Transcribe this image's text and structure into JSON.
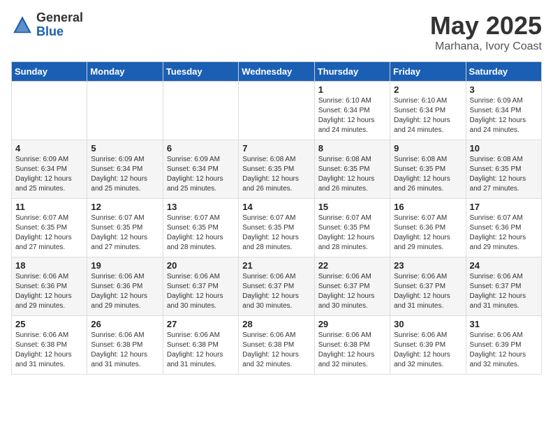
{
  "header": {
    "logo_general": "General",
    "logo_blue": "Blue",
    "month_year": "May 2025",
    "location": "Marhana, Ivory Coast"
  },
  "weekdays": [
    "Sunday",
    "Monday",
    "Tuesday",
    "Wednesday",
    "Thursday",
    "Friday",
    "Saturday"
  ],
  "weeks": [
    [
      {
        "day": "",
        "info": ""
      },
      {
        "day": "",
        "info": ""
      },
      {
        "day": "",
        "info": ""
      },
      {
        "day": "",
        "info": ""
      },
      {
        "day": "1",
        "info": "Sunrise: 6:10 AM\nSunset: 6:34 PM\nDaylight: 12 hours\nand 24 minutes."
      },
      {
        "day": "2",
        "info": "Sunrise: 6:10 AM\nSunset: 6:34 PM\nDaylight: 12 hours\nand 24 minutes."
      },
      {
        "day": "3",
        "info": "Sunrise: 6:09 AM\nSunset: 6:34 PM\nDaylight: 12 hours\nand 24 minutes."
      }
    ],
    [
      {
        "day": "4",
        "info": "Sunrise: 6:09 AM\nSunset: 6:34 PM\nDaylight: 12 hours\nand 25 minutes."
      },
      {
        "day": "5",
        "info": "Sunrise: 6:09 AM\nSunset: 6:34 PM\nDaylight: 12 hours\nand 25 minutes."
      },
      {
        "day": "6",
        "info": "Sunrise: 6:09 AM\nSunset: 6:34 PM\nDaylight: 12 hours\nand 25 minutes."
      },
      {
        "day": "7",
        "info": "Sunrise: 6:08 AM\nSunset: 6:35 PM\nDaylight: 12 hours\nand 26 minutes."
      },
      {
        "day": "8",
        "info": "Sunrise: 6:08 AM\nSunset: 6:35 PM\nDaylight: 12 hours\nand 26 minutes."
      },
      {
        "day": "9",
        "info": "Sunrise: 6:08 AM\nSunset: 6:35 PM\nDaylight: 12 hours\nand 26 minutes."
      },
      {
        "day": "10",
        "info": "Sunrise: 6:08 AM\nSunset: 6:35 PM\nDaylight: 12 hours\nand 27 minutes."
      }
    ],
    [
      {
        "day": "11",
        "info": "Sunrise: 6:07 AM\nSunset: 6:35 PM\nDaylight: 12 hours\nand 27 minutes."
      },
      {
        "day": "12",
        "info": "Sunrise: 6:07 AM\nSunset: 6:35 PM\nDaylight: 12 hours\nand 27 minutes."
      },
      {
        "day": "13",
        "info": "Sunrise: 6:07 AM\nSunset: 6:35 PM\nDaylight: 12 hours\nand 28 minutes."
      },
      {
        "day": "14",
        "info": "Sunrise: 6:07 AM\nSunset: 6:35 PM\nDaylight: 12 hours\nand 28 minutes."
      },
      {
        "day": "15",
        "info": "Sunrise: 6:07 AM\nSunset: 6:35 PM\nDaylight: 12 hours\nand 28 minutes."
      },
      {
        "day": "16",
        "info": "Sunrise: 6:07 AM\nSunset: 6:36 PM\nDaylight: 12 hours\nand 29 minutes."
      },
      {
        "day": "17",
        "info": "Sunrise: 6:07 AM\nSunset: 6:36 PM\nDaylight: 12 hours\nand 29 minutes."
      }
    ],
    [
      {
        "day": "18",
        "info": "Sunrise: 6:06 AM\nSunset: 6:36 PM\nDaylight: 12 hours\nand 29 minutes."
      },
      {
        "day": "19",
        "info": "Sunrise: 6:06 AM\nSunset: 6:36 PM\nDaylight: 12 hours\nand 29 minutes."
      },
      {
        "day": "20",
        "info": "Sunrise: 6:06 AM\nSunset: 6:37 PM\nDaylight: 12 hours\nand 30 minutes."
      },
      {
        "day": "21",
        "info": "Sunrise: 6:06 AM\nSunset: 6:37 PM\nDaylight: 12 hours\nand 30 minutes."
      },
      {
        "day": "22",
        "info": "Sunrise: 6:06 AM\nSunset: 6:37 PM\nDaylight: 12 hours\nand 30 minutes."
      },
      {
        "day": "23",
        "info": "Sunrise: 6:06 AM\nSunset: 6:37 PM\nDaylight: 12 hours\nand 31 minutes."
      },
      {
        "day": "24",
        "info": "Sunrise: 6:06 AM\nSunset: 6:37 PM\nDaylight: 12 hours\nand 31 minutes."
      }
    ],
    [
      {
        "day": "25",
        "info": "Sunrise: 6:06 AM\nSunset: 6:38 PM\nDaylight: 12 hours\nand 31 minutes."
      },
      {
        "day": "26",
        "info": "Sunrise: 6:06 AM\nSunset: 6:38 PM\nDaylight: 12 hours\nand 31 minutes."
      },
      {
        "day": "27",
        "info": "Sunrise: 6:06 AM\nSunset: 6:38 PM\nDaylight: 12 hours\nand 31 minutes."
      },
      {
        "day": "28",
        "info": "Sunrise: 6:06 AM\nSunset: 6:38 PM\nDaylight: 12 hours\nand 32 minutes."
      },
      {
        "day": "29",
        "info": "Sunrise: 6:06 AM\nSunset: 6:38 PM\nDaylight: 12 hours\nand 32 minutes."
      },
      {
        "day": "30",
        "info": "Sunrise: 6:06 AM\nSunset: 6:39 PM\nDaylight: 12 hours\nand 32 minutes."
      },
      {
        "day": "31",
        "info": "Sunrise: 6:06 AM\nSunset: 6:39 PM\nDaylight: 12 hours\nand 32 minutes."
      }
    ]
  ]
}
